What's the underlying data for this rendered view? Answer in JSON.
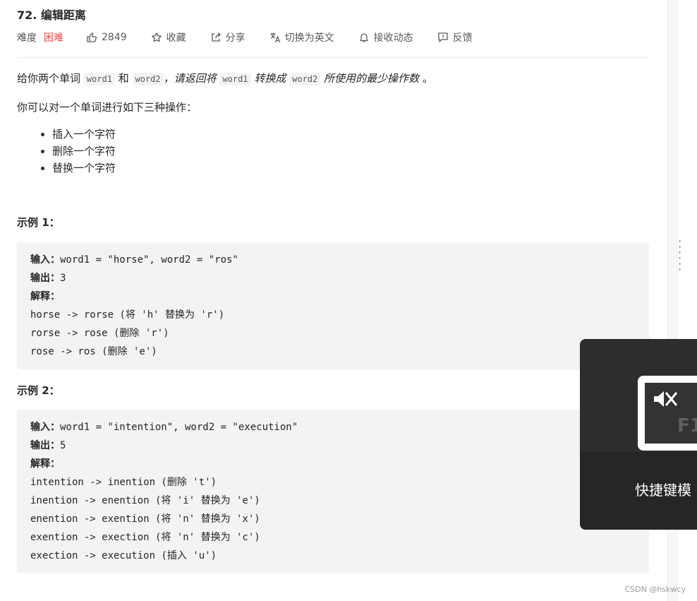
{
  "problem": {
    "title": "72. 编辑距离",
    "difficulty_label": "难度",
    "difficulty_value": "困难",
    "likes": "2849",
    "actions": {
      "favorite": "收藏",
      "share": "分享",
      "switch_lang": "切换为英文",
      "subscribe": "接收动态",
      "feedback": "反馈"
    }
  },
  "description": {
    "p1_pre": "给你两个单词",
    "word1": "word1",
    "and": "和",
    "word2": "word2",
    "p1_italic_1": "，请返回将",
    "p1_italic_2": "转换成",
    "p1_italic_3": "所使用的最少操作数",
    "p1_end": "。",
    "p2": "你可以对一个单词进行如下三种操作：",
    "ops": [
      "插入一个字符",
      "删除一个字符",
      "替换一个字符"
    ]
  },
  "examples": [
    {
      "title": "示例 1：",
      "input_label": "输入：",
      "input_value": "word1 = \"horse\", word2 = \"ros\"",
      "output_label": "输出：",
      "output_value": "3",
      "explain_label": "解释：",
      "steps": [
        "horse -> rorse (将 'h' 替换为 'r')",
        "rorse -> rose (删除 'r')",
        "rose -> ros (删除 'e')"
      ]
    },
    {
      "title": "示例 2：",
      "input_label": "输入：",
      "input_value": "word1 = \"intention\", word2 = \"execution\"",
      "output_label": "输出：",
      "output_value": "5",
      "explain_label": "解释：",
      "steps": [
        "intention -> inention (删除 't')",
        "inention -> enention (将 'i' 替换为 'e')",
        "enention -> exention (将 'n' 替换为 'x')",
        "exention -> exection (将 'n' 替换为 'c')",
        "exection -> execution (插入 'u')"
      ]
    }
  ],
  "overlay": {
    "key_text": "F1",
    "caption": "快捷键模"
  },
  "watermark": "CSDN @hskwcy",
  "colors": {
    "difficulty_hard": "#ef4743",
    "code_bg": "#f2f3f4",
    "overlay_bg": "#2d2d2d"
  }
}
